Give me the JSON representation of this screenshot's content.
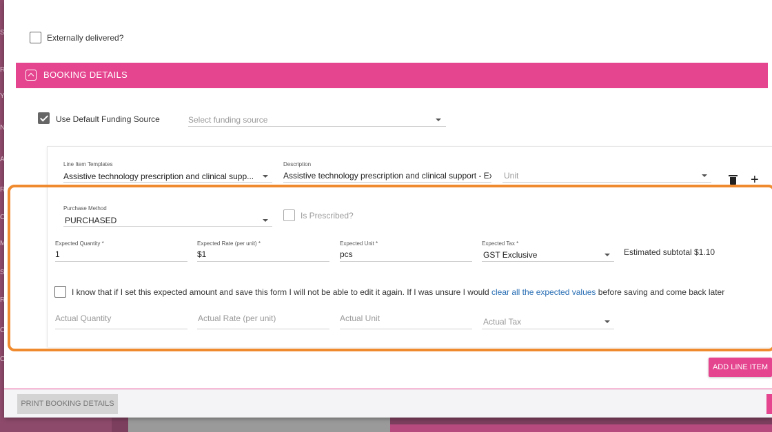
{
  "background": {
    "side_letters": [
      "S",
      "R",
      "Y",
      "N",
      "A",
      "R",
      "O",
      "M",
      "S",
      "R",
      "O",
      "O"
    ]
  },
  "externally_delivered": {
    "label": "Externally delivered?",
    "checked": false
  },
  "booking_section": {
    "title": "BOOKING DETAILS"
  },
  "funding": {
    "use_default_label": "Use Default Funding Source",
    "use_default_checked": true,
    "select_placeholder": "Select funding source"
  },
  "line_item": {
    "template_label": "Line Item Templates",
    "template_value": "Assistive technology prescription and clinical supp...",
    "description_label": "Description",
    "description_value": "Assistive technology prescription and clinical support - Ex",
    "unit_placeholder": "Unit"
  },
  "purchase": {
    "method_label": "Purchase Method",
    "method_value": "PURCHASED",
    "is_prescribed_label": "Is Prescribed?",
    "is_prescribed_checked": false
  },
  "expected": {
    "quantity_label": "Expected Quantity *",
    "quantity_value": "1",
    "rate_label": "Expected Rate (per unit) *",
    "rate_value": "$1",
    "unit_label": "Expected Unit *",
    "unit_value": "pcs",
    "tax_label": "Expected Tax *",
    "tax_value": "GST Exclusive",
    "subtotal_text": "Estimated subtotal $1.10"
  },
  "confirm": {
    "checked": false,
    "text_before": "I know that if I set this expected amount and save this form I will not be able to edit it again. If I was unsure I would",
    "link_text": "clear all the expected values",
    "text_after": "before saving and come back later"
  },
  "actual": {
    "quantity_placeholder": "Actual Quantity",
    "rate_placeholder": "Actual Rate (per unit)",
    "unit_placeholder": "Actual Unit",
    "tax_placeholder": "Actual Tax"
  },
  "buttons": {
    "add_line_item": "ADD LINE ITEM",
    "print_booking": "PRINT BOOKING DETAILS"
  },
  "colors": {
    "accent": "#e5458f",
    "highlight": "#f08a2e",
    "link": "#2a6fb5"
  }
}
